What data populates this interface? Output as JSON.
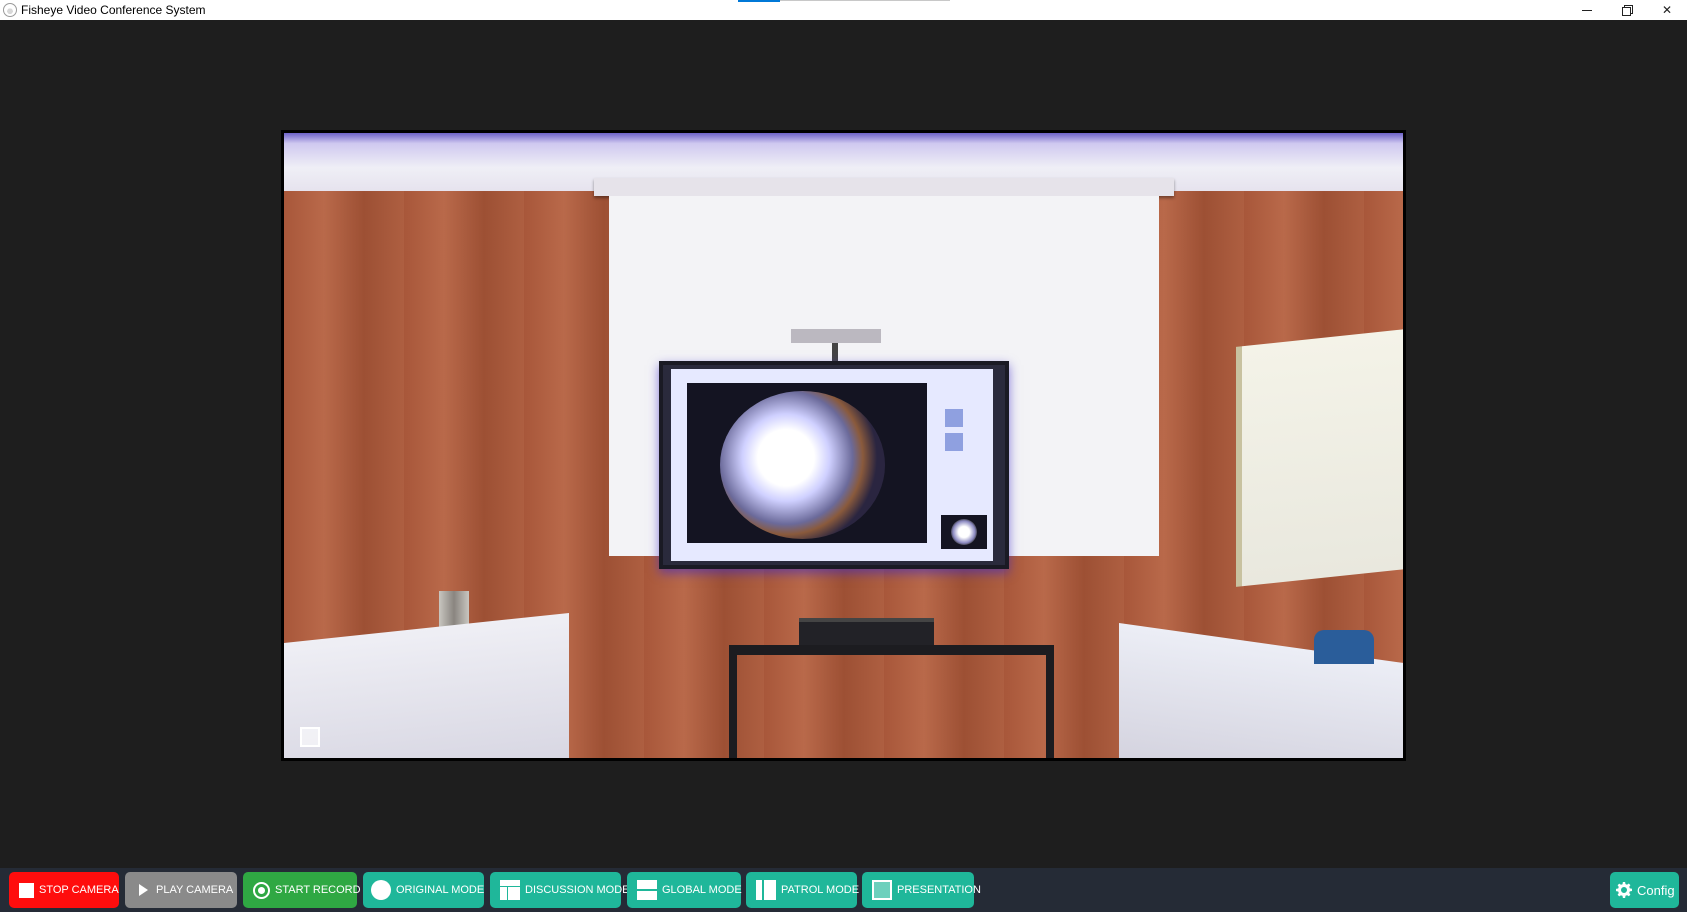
{
  "window": {
    "title": "Fisheye Video Conference System",
    "minimize_icon": "minimize-icon",
    "restore_icon": "restore-icon",
    "close_icon": "close-icon",
    "close_glyph": "✕"
  },
  "video": {
    "content": "conference room camera feed"
  },
  "toolbar": {
    "stop_camera": "STOP CAMERA",
    "play_camera": "PLAY CAMERA",
    "start_record": "START RECORD",
    "original_mode": "ORIGINAL MODE",
    "discussion_mode": "DISCUSSION MODE",
    "global_mode": "GLOBAL MODE",
    "patrol_mode": "PATROL MODE",
    "presentation": "PRESENTATION",
    "config": "Config"
  },
  "colors": {
    "stop": "#ff0d0d",
    "play": "#8a8a8a",
    "record": "#2fa843",
    "mode": "#1fb79a",
    "toolbar_bg": "#252b36",
    "window_bg": "#1e1e1e"
  }
}
